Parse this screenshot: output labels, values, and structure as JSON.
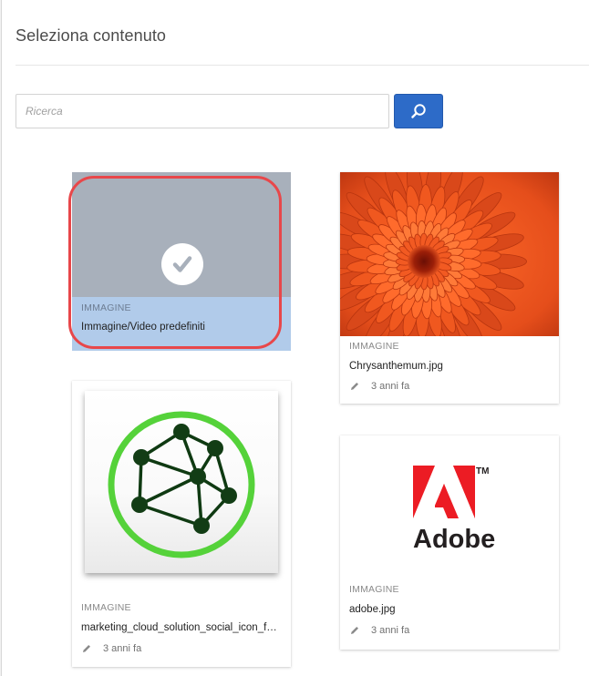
{
  "dialog": {
    "title": "Seleziona contenuto"
  },
  "search": {
    "placeholder": "Ricerca",
    "value": "",
    "button_icon": "search-icon"
  },
  "colors": {
    "accent": "#2d6bc8",
    "selection_highlight": "#e8474a",
    "selected_tile": "#b1cbea"
  },
  "assets": [
    {
      "type": "IMMAGINE",
      "name": "Immagine/Video predefiniti",
      "selected": true,
      "selected_icon": "checkmark-icon"
    },
    {
      "type": "IMMAGINE",
      "name": "Chrysanthemum.jpg",
      "modified": "3 anni fa",
      "thumbnail": "orange-chrysanthemum-photo"
    },
    {
      "type": "IMMAGINE",
      "name": "marketing_cloud_solution_social_icon_for...",
      "modified": "3 anni fa",
      "thumbnail": "network-graph-icon"
    },
    {
      "type": "IMMAGINE",
      "name": "adobe.jpg",
      "modified": "3 anni fa",
      "thumbnail": "adobe-logo",
      "logo_text": "Adobe",
      "logo_trademark": "TM"
    }
  ]
}
